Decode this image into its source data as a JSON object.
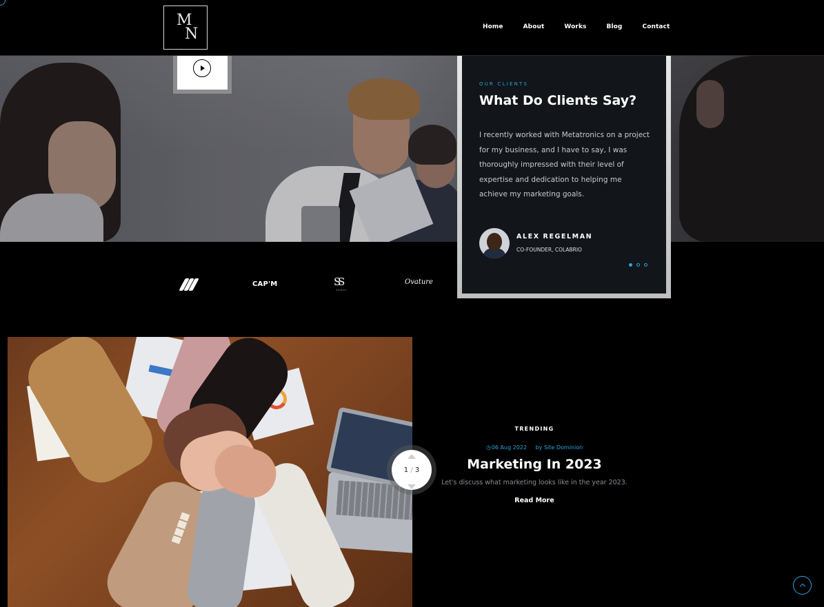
{
  "header": {
    "logo_top": "M",
    "logo_bottom": "N",
    "nav": [
      "Home",
      "About",
      "Works",
      "Blog",
      "Contact"
    ]
  },
  "testimonial": {
    "eyebrow": "OUR CLIENTS",
    "title": "What Do Clients Say?",
    "quote": "I recently worked with Metatronics on a project for my business, and I have to say, I was thoroughly impressed with their level of expertise and dedication to helping me achieve my marketing goals.",
    "name": "ALEX REGELMAN",
    "role": "CO-FOUNDER, COLABRIO",
    "slides_total": 3,
    "active_slide": 1
  },
  "client_logos": {
    "cap": "CAP'M",
    "ss_sub": "SUNSH",
    "ov": "Ovature"
  },
  "post": {
    "tag": "TRENDING",
    "date": "06 Aug 2022",
    "author": "by Site Dominion",
    "title": "Marketing In 2023",
    "excerpt": "Let's discuss what marketing looks like in the year 2023.",
    "read_more": "Read More",
    "current": "1",
    "total": "3"
  },
  "colors": {
    "accent": "#2aa5e0",
    "background": "#000000",
    "card": "#121519"
  },
  "icons": [
    "play-icon",
    "clock-icon",
    "scroll-top-icon",
    "arrow-up-icon",
    "arrow-down-icon"
  ]
}
